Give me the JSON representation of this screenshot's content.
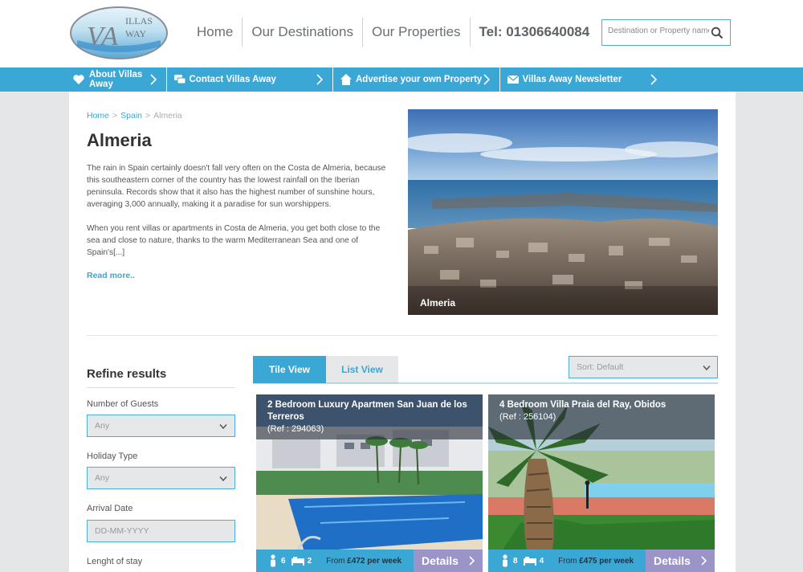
{
  "brand": {
    "logo_text": "VILLAS AWAY",
    "logo_mark": "VA"
  },
  "nav": {
    "items": [
      "Home",
      "Our Destinations",
      "Our Properties"
    ],
    "tel": "Tel: 01306640084"
  },
  "search": {
    "placeholder": "Destination or Property name"
  },
  "bluebar": [
    {
      "label": "About Villas Away",
      "icon": "heart-icon"
    },
    {
      "label": "Contact Villas Away",
      "icon": "chat-icon"
    },
    {
      "label": "Advertise your own Property",
      "icon": "house-icon"
    },
    {
      "label": "Villas Away Newsletter",
      "icon": "envelope-icon"
    }
  ],
  "breadcrumb": {
    "home": "Home",
    "country": "Spain",
    "current": "Almeria",
    "sep": ">"
  },
  "page": {
    "title": "Almeria",
    "para1": "The rain in Spain certainly doesn't fall very often on the Costa de Almeria, because this southeastern corner of the country has the lowest rainfall on the Iberian peninsula. Records show that it also has the highest number of sunshine hours, averaging 3,000 annually, making it a paradise for sun worshippers.",
    "para2": "When you rent villas or apartments in Costa de Almeria, you get both close to the sea and close to nature, thanks to the warm Mediterranean Sea and one of Spain's[...]",
    "read_more": "Read more..",
    "hero_caption": "Almeria"
  },
  "refine": {
    "title": "Refine results",
    "guests_label": "Number of Guests",
    "guests_value": "Any",
    "type_label": "Holiday Type",
    "type_value": "Any",
    "arrival_label": "Arrival Date",
    "arrival_placeholder": "DD-MM-YYYY",
    "stay_label": "Lenght of stay"
  },
  "tabs": {
    "tile": "Tile View",
    "list": "List View"
  },
  "sort": {
    "value": "Sort: Default"
  },
  "cards": [
    {
      "title": "2 Bedroom Luxury Apartmen San Juan de los Terreros",
      "ref": "(Ref : 294063)",
      "guests": "6",
      "bedrooms": "2",
      "price_prefix": "From",
      "price": "£472 per week",
      "details": "Details"
    },
    {
      "title": "4 Bedroom Villa Praia del Ray, Obidos",
      "ref": "(Ref : 256104)",
      "guests": "8",
      "bedrooms": "4",
      "price_prefix": "From",
      "price": "£475 per week",
      "details": "Details"
    }
  ],
  "colors": {
    "accent": "#3aa7d4",
    "details": "#9b94c9",
    "panel": "#ffffff",
    "background": "#e5e6e8"
  }
}
